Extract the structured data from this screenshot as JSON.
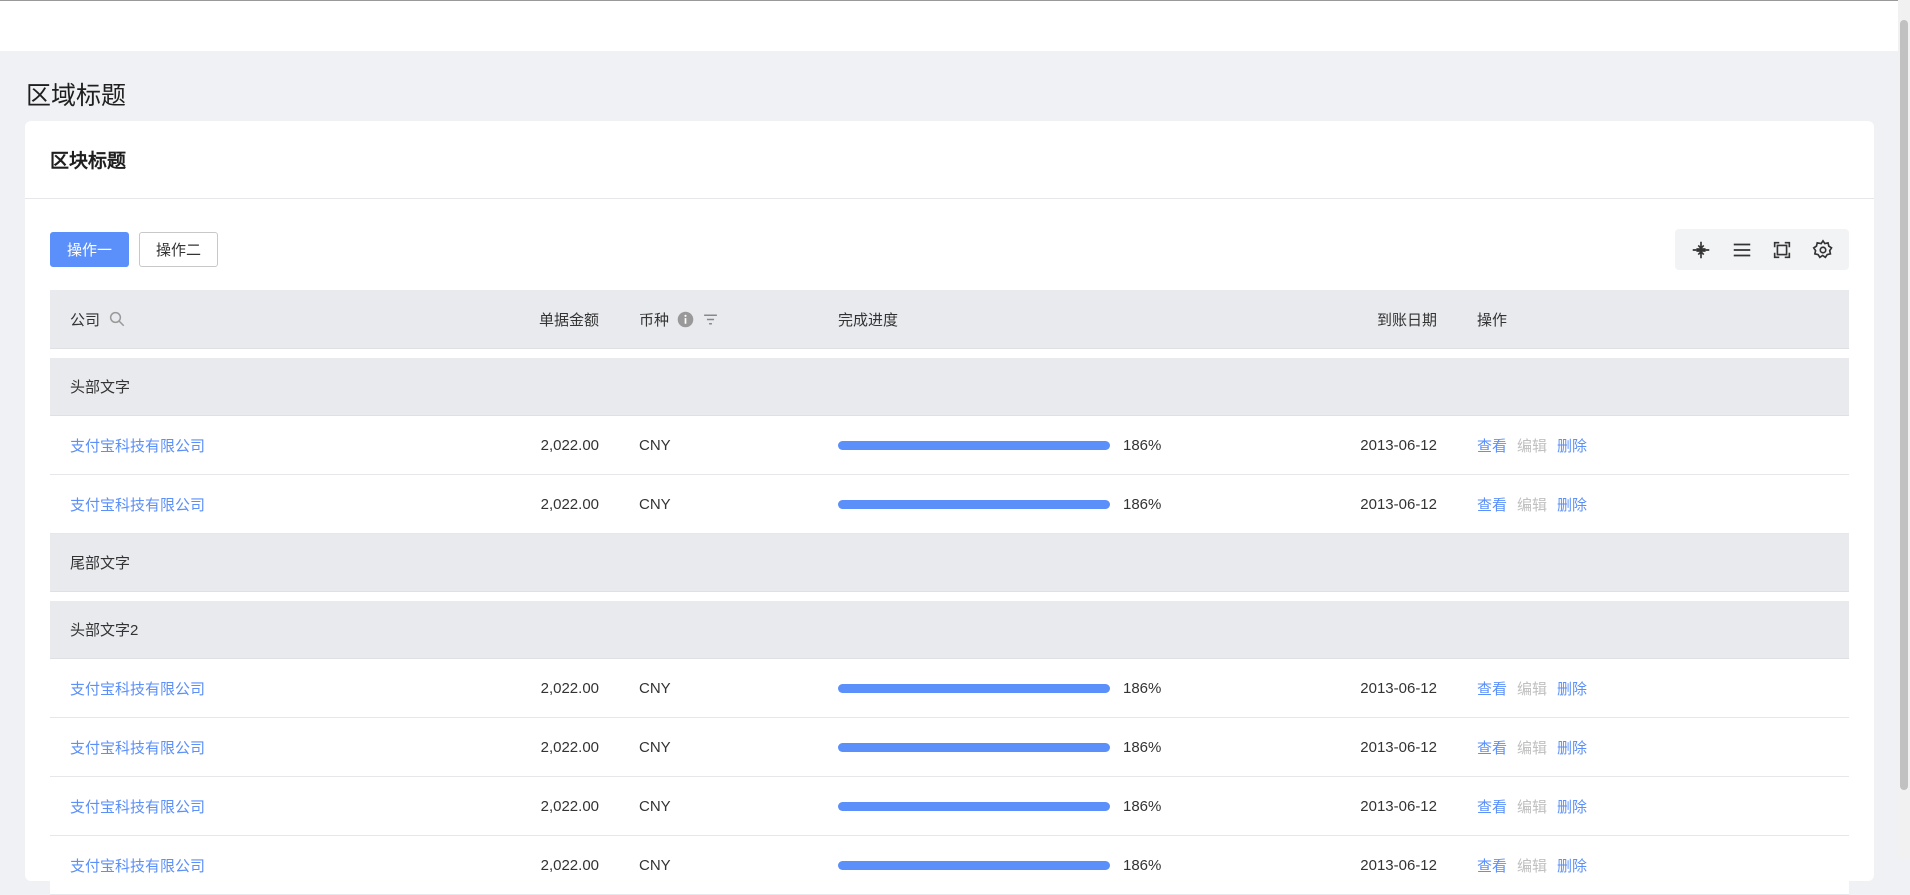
{
  "page": {
    "title": "区域标题"
  },
  "card": {
    "title": "区块标题"
  },
  "toolbar": {
    "primary_label": "操作一",
    "secondary_label": "操作二"
  },
  "tools": [
    "compress-icon",
    "density-icon",
    "fullscreen-icon",
    "settings-icon"
  ],
  "table": {
    "columns": {
      "company": "公司",
      "amount": "单据金额",
      "currency": "币种",
      "progress": "完成进度",
      "date": "到账日期",
      "actions": "操作"
    },
    "groups": [
      {
        "header": "头部文字",
        "footer": "尾部文字",
        "rows": [
          {
            "company": "支付宝科技有限公司",
            "amount": "2,022.00",
            "currency": "CNY",
            "progress": 1.86,
            "progress_label": "186%",
            "date": "2013-06-12",
            "actions": [
              "查看",
              "编辑",
              "删除"
            ]
          },
          {
            "company": "支付宝科技有限公司",
            "amount": "2,022.00",
            "currency": "CNY",
            "progress": 1.86,
            "progress_label": "186%",
            "date": "2013-06-12",
            "actions": [
              "查看",
              "编辑",
              "删除"
            ]
          }
        ]
      },
      {
        "header": "头部文字2",
        "footer": "",
        "rows": [
          {
            "company": "支付宝科技有限公司",
            "amount": "2,022.00",
            "currency": "CNY",
            "progress": 1.86,
            "progress_label": "186%",
            "date": "2013-06-12",
            "actions": [
              "查看",
              "编辑",
              "删除"
            ]
          },
          {
            "company": "支付宝科技有限公司",
            "amount": "2,022.00",
            "currency": "CNY",
            "progress": 1.86,
            "progress_label": "186%",
            "date": "2013-06-12",
            "actions": [
              "查看",
              "编辑",
              "删除"
            ]
          },
          {
            "company": "支付宝科技有限公司",
            "amount": "2,022.00",
            "currency": "CNY",
            "progress": 1.86,
            "progress_label": "186%",
            "date": "2013-06-12",
            "actions": [
              "查看",
              "编辑",
              "删除"
            ]
          },
          {
            "company": "支付宝科技有限公司",
            "amount": "2,022.00",
            "currency": "CNY",
            "progress": 1.86,
            "progress_label": "186%",
            "date": "2013-06-12",
            "actions": [
              "查看",
              "编辑",
              "删除"
            ]
          }
        ]
      }
    ]
  },
  "colors": {
    "primary": "#5b8ff9",
    "disabled": "#c0c0c0",
    "header_bg": "#e9eaee",
    "page_bg": "#f0f1f4"
  }
}
